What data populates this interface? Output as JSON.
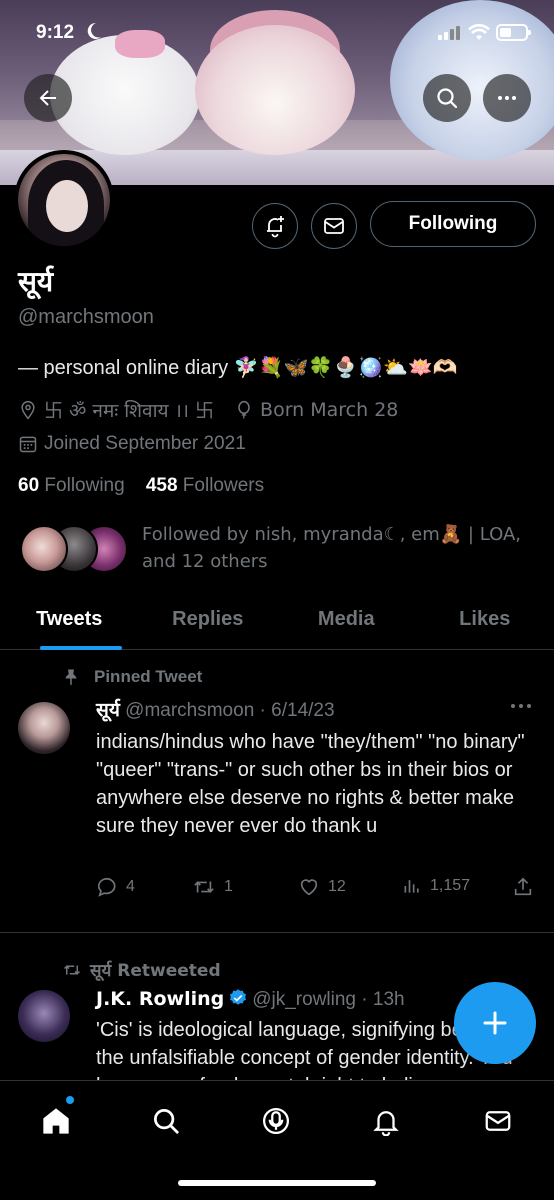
{
  "status_bar": {
    "time": "9:12"
  },
  "profile": {
    "name": "सूर्य",
    "handle": "@marchsmoon",
    "bio": "— personal online diary 🧚🏻‍♀️💐🦋🍀🍨🪩⛅🪷🫶🏻",
    "location": "卐 ॐ नमः शिवाय ।। 卐",
    "birthday": "Born March 28",
    "joined": "Joined September 2021",
    "following_count": "60",
    "following_label": "Following",
    "followers_count": "458",
    "followers_label": "Followers",
    "followed_by": "Followed by nish, myranda☾, em🧸 | LOA, and 12 others",
    "following_button": "Following"
  },
  "tabs": [
    {
      "label": "Tweets",
      "active": true
    },
    {
      "label": "Replies",
      "active": false
    },
    {
      "label": "Media",
      "active": false
    },
    {
      "label": "Likes",
      "active": false
    }
  ],
  "pinned_tweet": {
    "label": "Pinned Tweet",
    "name": "सूर्य",
    "handle": "@marchsmoon",
    "date": "6/14/23",
    "text": "indians/hindus who have \"they/them\" \"no binary\" \"queer\" \"trans-\" or such other bs in their bios or anywhere else deserve no rights & better make sure they never ever do thank u",
    "replies": "4",
    "retweets": "1",
    "likes": "12",
    "views": "1,157"
  },
  "retweet": {
    "label": "सूर्य Retweeted",
    "name": "J.K. Rowling",
    "handle": "@jk_rowling",
    "time": "13h",
    "text": "'Cis' is ideological language, signifying belief in the unfalsifiable concept of gender identity. You have every fundamental right to believe"
  },
  "colors": {
    "accent": "#1d9bf0",
    "muted": "#71767b",
    "border": "#2f3336"
  },
  "icons": [
    "back-arrow-icon",
    "search-icon",
    "more-icon",
    "notify-bell-icon",
    "mail-icon",
    "location-pin-icon",
    "balloon-icon",
    "calendar-icon",
    "pin-icon",
    "retweet-icon",
    "reply-icon",
    "like-icon",
    "views-icon",
    "share-icon",
    "verified-icon",
    "plus-icon",
    "home-icon",
    "spaces-icon",
    "bell-icon"
  ]
}
